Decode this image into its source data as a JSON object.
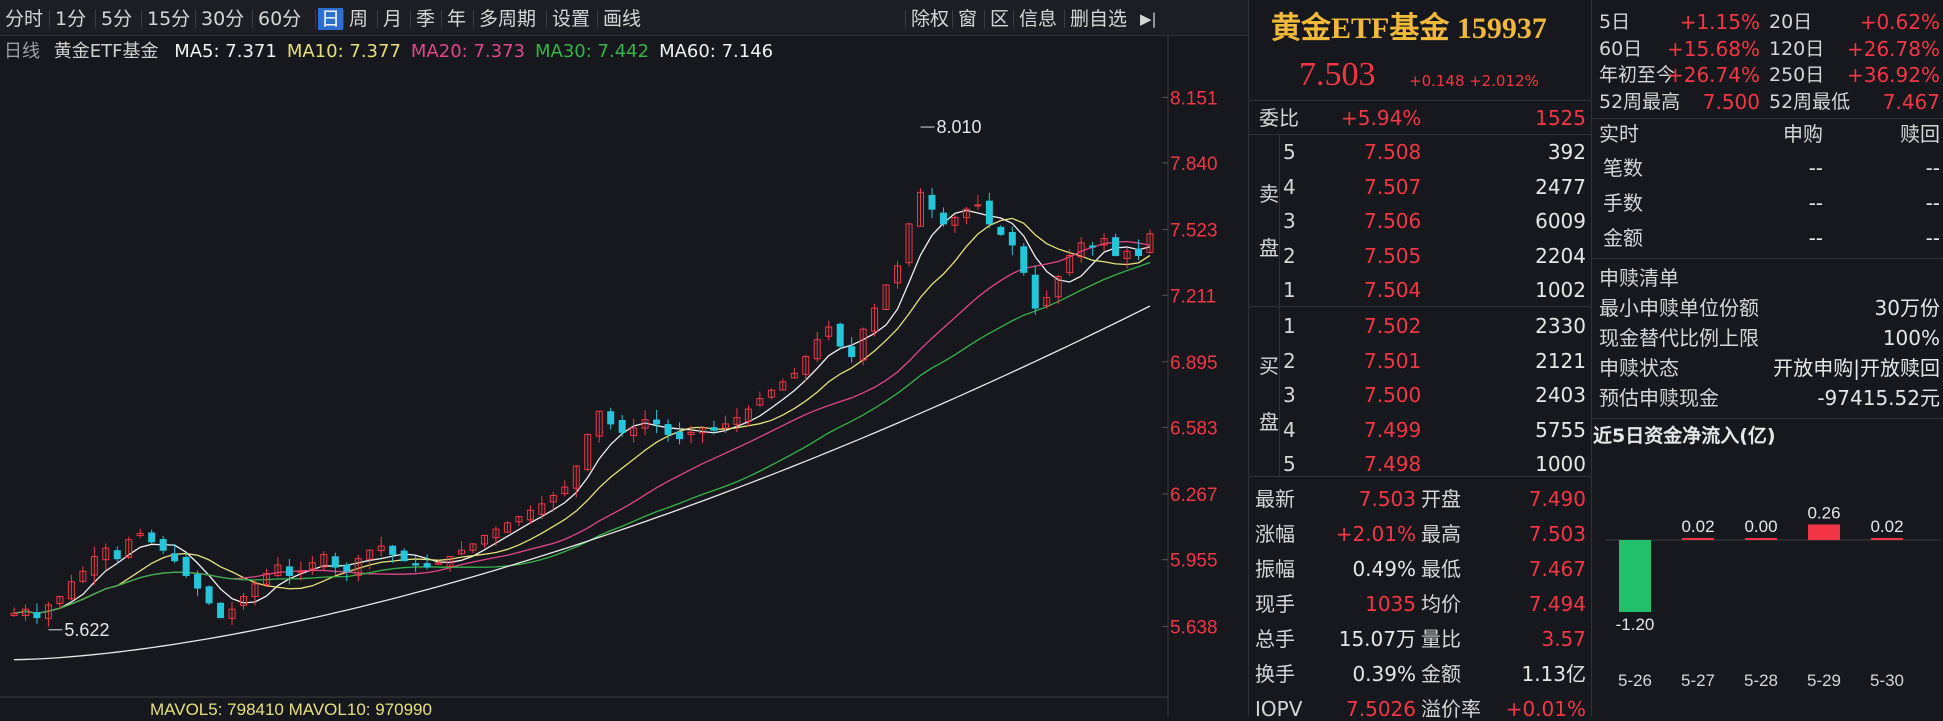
{
  "toolbar": {
    "periods": [
      "分时",
      "1分",
      "5分",
      "15分",
      "30分",
      "60分",
      "日",
      "周",
      "月",
      "季",
      "年",
      "多周期",
      "设置",
      "画线"
    ],
    "selected": "日",
    "right_tools": [
      "除权",
      "窗",
      "区",
      "信息",
      "删自选"
    ],
    "collapse_icon": "collapse-right-icon"
  },
  "ma_line": {
    "label": "日线",
    "name": "黄金ETF基金",
    "items": [
      {
        "label": "MA5: 7.371",
        "color": "#f0f0f0"
      },
      {
        "label": "MA10: 7.377",
        "color": "#e6e07a"
      },
      {
        "label": "MA20: 7.373",
        "color": "#e0468c"
      },
      {
        "label": "MA30: 7.442",
        "color": "#36b34a"
      },
      {
        "label": "MA60: 7.146",
        "color": "#f0f0f0"
      }
    ]
  },
  "chart_data": {
    "type": "candlestick",
    "y_ticks": [
      "8.151",
      "7.840",
      "7.523",
      "7.211",
      "6.895",
      "6.583",
      "6.267",
      "5.955",
      "5.638"
    ],
    "ylim": [
      5.45,
      8.3
    ],
    "high_label": "8.010",
    "low_label": "5.622",
    "ma60_start": 5.48,
    "ma60_end": 7.16,
    "closes": [
      5.7,
      5.72,
      5.68,
      5.74,
      5.78,
      5.85,
      5.9,
      5.97,
      6.01,
      5.96,
      6.05,
      6.08,
      6.04,
      6.0,
      5.95,
      5.88,
      5.82,
      5.75,
      5.68,
      5.72,
      5.78,
      5.84,
      5.89,
      5.93,
      5.88,
      5.9,
      5.94,
      5.98,
      5.92,
      5.9,
      5.96,
      6.0,
      6.02,
      5.98,
      5.95,
      5.93,
      5.92,
      5.94,
      5.97,
      6.0,
      6.03,
      6.07,
      6.1,
      6.13,
      6.16,
      6.19,
      6.22,
      6.26,
      6.3,
      6.4,
      6.55,
      6.66,
      6.6,
      6.56,
      6.58,
      6.62,
      6.6,
      6.55,
      6.53,
      6.56,
      6.58,
      6.57,
      6.6,
      6.63,
      6.67,
      6.72,
      6.76,
      6.8,
      6.84,
      6.92,
      7.0,
      7.06,
      6.97,
      6.92,
      7.05,
      7.15,
      7.26,
      7.35,
      7.55,
      7.7,
      7.62,
      7.55,
      7.58,
      7.62,
      7.64,
      7.55,
      7.5,
      7.45,
      7.32,
      7.15,
      7.2,
      7.3,
      7.4,
      7.46,
      7.44,
      7.48,
      7.4,
      7.42,
      7.4,
      7.503
    ],
    "footer_partial": "MAVOL5: 798410   MAVOL10: 970990"
  },
  "quote": {
    "title": "黄金ETF基金 159937",
    "price": "7.503",
    "change": "+0.148",
    "change_pct": "+2.012%",
    "stats": [
      {
        "label": "5日",
        "value": "+1.15%"
      },
      {
        "label": "20日",
        "value": "+0.62%"
      },
      {
        "label": "60日",
        "value": "+15.68%"
      },
      {
        "label": "120日",
        "value": "+26.78%"
      },
      {
        "label": "年初至今",
        "value": "+26.74%"
      },
      {
        "label": "250日",
        "value": "+36.92%"
      },
      {
        "label": "52周最高",
        "value": "7.500"
      },
      {
        "label": "52周最低",
        "value": "7.467"
      }
    ],
    "weibi": {
      "label": "委比",
      "pct": "+5.94%",
      "vol": "1525"
    },
    "sell_label": [
      "卖",
      "盘"
    ],
    "buy_label": [
      "买",
      "盘"
    ],
    "sell": [
      {
        "lvl": "5",
        "price": "7.508",
        "vol": "392"
      },
      {
        "lvl": "4",
        "price": "7.507",
        "vol": "2477"
      },
      {
        "lvl": "3",
        "price": "7.506",
        "vol": "6009"
      },
      {
        "lvl": "2",
        "price": "7.505",
        "vol": "2204"
      },
      {
        "lvl": "1",
        "price": "7.504",
        "vol": "1002"
      }
    ],
    "buy": [
      {
        "lvl": "1",
        "price": "7.502",
        "vol": "2330"
      },
      {
        "lvl": "2",
        "price": "7.501",
        "vol": "2121"
      },
      {
        "lvl": "3",
        "price": "7.500",
        "vol": "2403"
      },
      {
        "lvl": "4",
        "price": "7.499",
        "vol": "5755"
      },
      {
        "lvl": "5",
        "price": "7.498",
        "vol": "1000"
      }
    ],
    "details": [
      {
        "l1": "最新",
        "v1": "7.503",
        "c1": "red",
        "l2": "开盘",
        "v2": "7.490",
        "c2": "red"
      },
      {
        "l1": "涨幅",
        "v1": "+2.01%",
        "c1": "red",
        "l2": "最高",
        "v2": "7.503",
        "c2": "red"
      },
      {
        "l1": "振幅",
        "v1": "0.49%",
        "c1": "white",
        "l2": "最低",
        "v2": "7.467",
        "c2": "red"
      },
      {
        "l1": "现手",
        "v1": "1035",
        "c1": "red",
        "l2": "均价",
        "v2": "7.494",
        "c2": "red"
      },
      {
        "l1": "总手",
        "v1": "15.07万",
        "c1": "white",
        "l2": "量比",
        "v2": "3.57",
        "c2": "red"
      },
      {
        "l1": "换手",
        "v1": "0.39%",
        "c1": "white",
        "l2": "金额",
        "v2": "1.13亿",
        "c2": "white"
      },
      {
        "l1": "IOPV",
        "v1": "7.5026",
        "c1": "red",
        "l2": "溢价率",
        "v2": "+0.01%",
        "c2": "red"
      }
    ]
  },
  "redemption": {
    "header": [
      "实时",
      "申购",
      "赎回"
    ],
    "rows": [
      {
        "label": "笔数",
        "a": "--",
        "b": "--"
      },
      {
        "label": "手数",
        "a": "--",
        "b": "--"
      },
      {
        "label": "金额",
        "a": "--",
        "b": "--"
      }
    ],
    "list_title": "申赎清单",
    "list": [
      {
        "label": "最小申赎单位份额",
        "value": "30万份"
      },
      {
        "label": "现金替代比例上限",
        "value": "100%"
      },
      {
        "label": "申赎状态",
        "value": "开放申购|开放赎回"
      },
      {
        "label": "预估申赎现金",
        "value": "-97415.52元"
      }
    ]
  },
  "flow": {
    "title": "近5日资金净流入(亿)",
    "days": [
      "5-26",
      "5-27",
      "5-28",
      "5-29",
      "5-30"
    ],
    "values": [
      -1.2,
      0.02,
      0.0,
      0.26,
      0.02
    ],
    "labels": [
      "-1.20",
      "0.02",
      "0.00",
      "0.26",
      "0.02"
    ]
  },
  "colors": {
    "up": "#f23645",
    "down": "#26c6da",
    "bg": "#16181d"
  }
}
